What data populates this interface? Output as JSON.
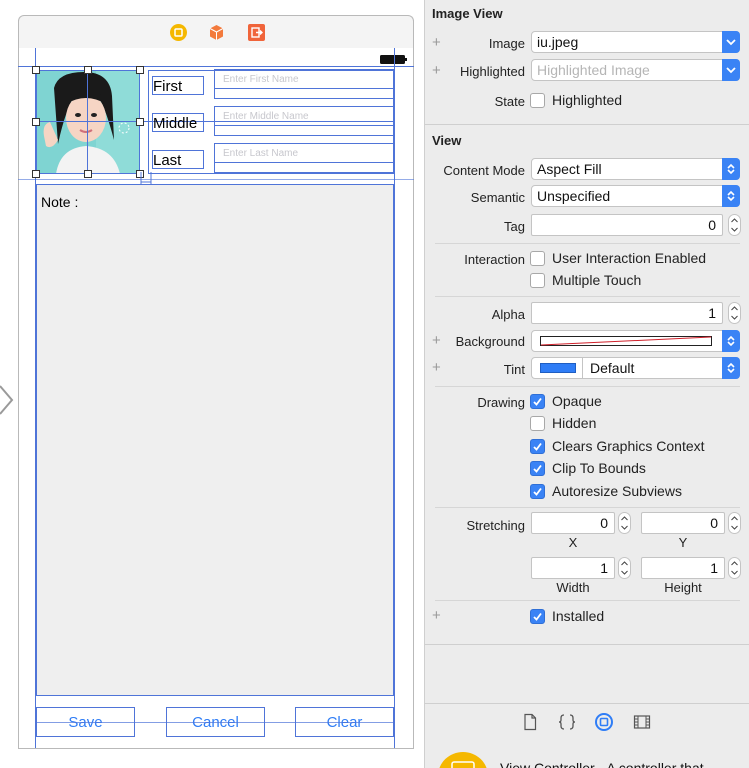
{
  "scene": {
    "first_label": "First",
    "middle_label": "Middle",
    "last_label": "Last",
    "first_placeholder": "Enter First Name",
    "middle_placeholder": "Enter Middle Name",
    "last_placeholder": "Enter Last Name",
    "note_label": "Note :",
    "save_label": "Save",
    "cancel_label": "Cancel",
    "clear_label": "Clear"
  },
  "image_view": {
    "title": "Image View",
    "image_label": "Image",
    "image_value": "iu.jpeg",
    "highlighted_label": "Highlighted",
    "highlighted_placeholder": "Highlighted Image",
    "state_label": "State",
    "state_checkbox": "Highlighted"
  },
  "view": {
    "title": "View",
    "content_mode_label": "Content Mode",
    "content_mode_value": "Aspect Fill",
    "semantic_label": "Semantic",
    "semantic_value": "Unspecified",
    "tag_label": "Tag",
    "tag_value": "0",
    "interaction_label": "Interaction",
    "user_interaction": "User Interaction Enabled",
    "multiple_touch": "Multiple Touch",
    "alpha_label": "Alpha",
    "alpha_value": "1",
    "background_label": "Background",
    "tint_label": "Tint",
    "tint_value": "Default",
    "tint_color": "#2f7df6",
    "drawing_label": "Drawing",
    "opaque": "Opaque",
    "hidden": "Hidden",
    "clears_graphics": "Clears Graphics Context",
    "clip_to_bounds": "Clip To Bounds",
    "autoresize": "Autoresize Subviews",
    "stretching_label": "Stretching",
    "stretch_x_value": "0",
    "stretch_y_value": "0",
    "x_label": "X",
    "y_label": "Y",
    "width_value": "1",
    "height_value": "1",
    "width_label": "Width",
    "height_label": "Height",
    "installed": "Installed"
  },
  "library": {
    "text": "View Controller - A controller that"
  },
  "colors": {
    "accent": "#3a83f5",
    "guide": "#4f74d8",
    "button_text": "#2f7df6"
  }
}
